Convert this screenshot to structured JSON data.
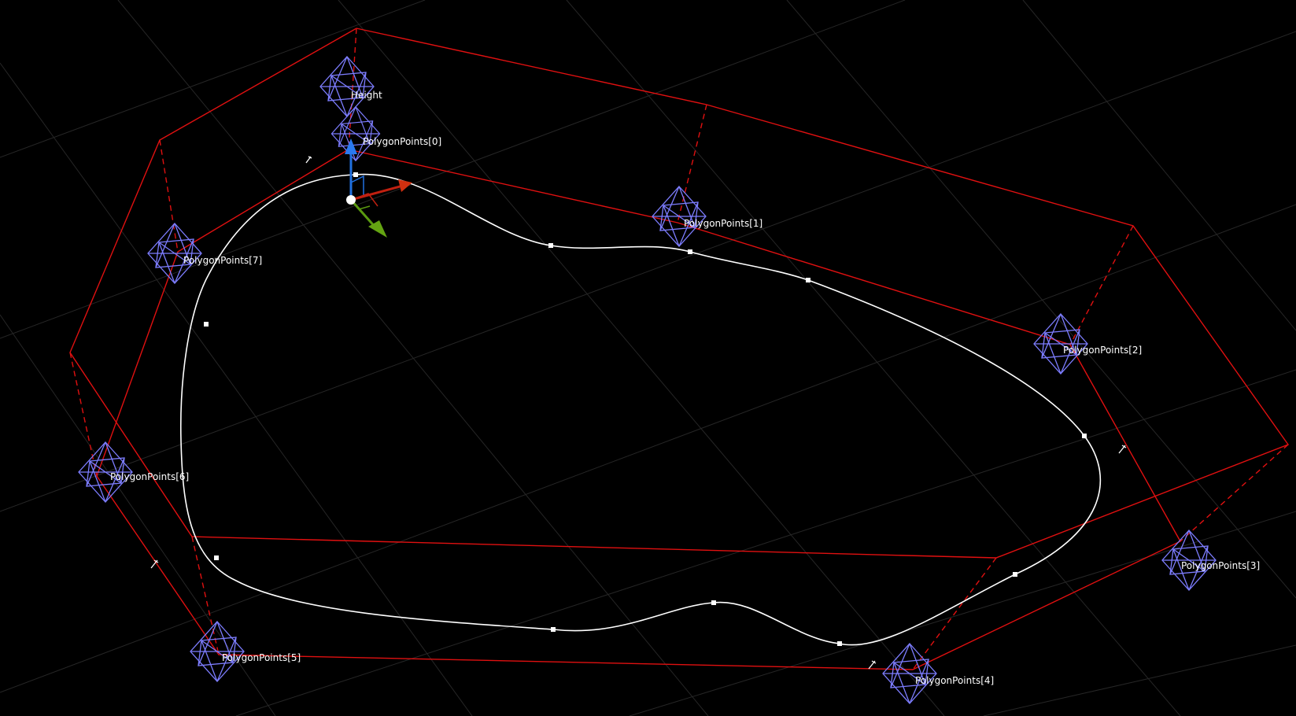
{
  "viewport": {
    "background": "#000000",
    "grid_color": "#2a2a2a",
    "volume_color": "#e01010",
    "spline_color": "#ffffff",
    "handle_color": "#8080ff",
    "gizmo_colors": {
      "x": "#d03010",
      "y": "#60a010",
      "z": "#2070e0"
    }
  },
  "handles": {
    "height": "Height",
    "p0": "PolygonPoints[0]",
    "p1": "PolygonPoints[1]",
    "p2": "PolygonPoints[2]",
    "p3": "PolygonPoints[3]",
    "p4": "PolygonPoints[4]",
    "p5": "PolygonPoints[5]",
    "p6": "PolygonPoints[6]",
    "p7": "PolygonPoints[7]"
  },
  "icons": [
    "octahedron-handle-icon",
    "translate-gizmo-icon",
    "pin-icon"
  ]
}
